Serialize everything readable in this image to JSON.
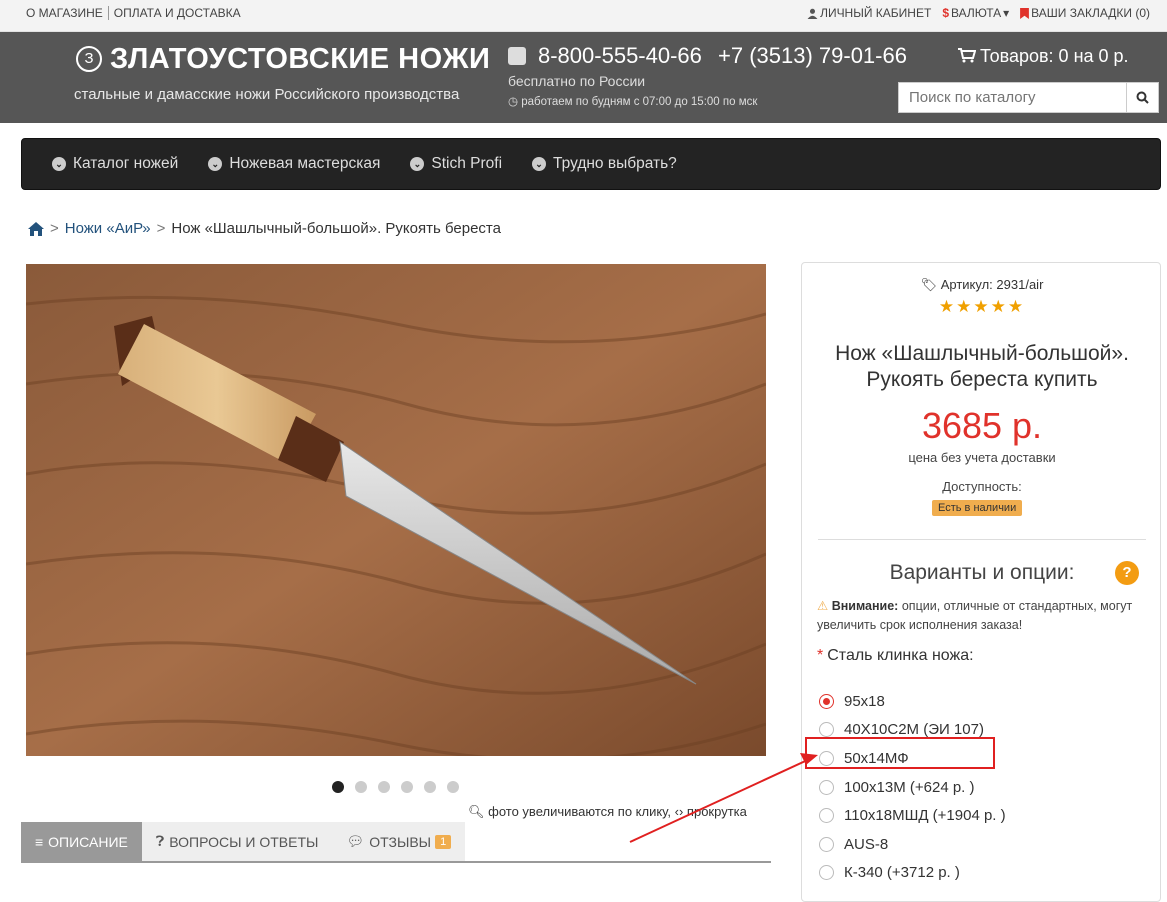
{
  "topbar": {
    "left_links": [
      "О МАГАЗИНЕ",
      "ОПЛАТА И ДОСТАВКА"
    ],
    "account": "ЛИЧНЫЙ КАБИНЕТ",
    "currency_symbol": "$",
    "currency": "ВАЛЮТА",
    "bookmarks": "ВАШИ ЗАКЛАДКИ (0)"
  },
  "header": {
    "logo_mark": "З",
    "logo_title": "ЗЛАТОУСТОВСКИЕ НОЖИ",
    "logo_sub": "стальные и дамасские ножи Российского производства",
    "phone1": "8-800-555-40-66",
    "phone_note": "бесплатно по России",
    "hours": "работаем по будням с 07:00 до 15:00 по мск",
    "phone2": "+7 (3513) 79-01-66",
    "cart": "Товаров: 0 на 0 р.",
    "search_placeholder": "Поиск по каталогу"
  },
  "nav": [
    "Каталог ножей",
    "Ножевая мастерская",
    "Stich Profi",
    "Трудно выбрать?"
  ],
  "breadcrumb": {
    "items": [
      "Ножи «АиР»",
      "Нож «Шашлычный-большой». Рукоять береста"
    ]
  },
  "gallery": {
    "dots": 6,
    "active_dot": 0,
    "zoom_note": "фото увеличиваются по клику,",
    "scroll_note": "прокрутка"
  },
  "tabs": [
    {
      "label": "ОПИСАНИЕ",
      "badge": ""
    },
    {
      "label": "ВОПРОСЫ И ОТВЕТЫ",
      "badge": ""
    },
    {
      "label": "ОТЗЫВЫ",
      "badge": "1"
    }
  ],
  "product": {
    "sku_label": "Артикул:",
    "sku": "2931/air",
    "rating": 5,
    "stars": "★★★★★",
    "title": "Нож «Шашлычный-большой». Рукоять береста купить",
    "price": "3685 р.",
    "price_note": "цена без учета доставки",
    "availability_label": "Доступность:",
    "availability": "Есть в наличии",
    "options_title": "Варианты и опции:",
    "warning_bold": "Внимание:",
    "warning_text": "опции, отличные от стандартных, могут увеличить срок исполнения заказа!",
    "steel_label": "Сталь клинка ножа:",
    "steel_options": [
      {
        "label": "95х18",
        "selected": true
      },
      {
        "label": "40Х10С2М (ЭИ 107)",
        "selected": false
      },
      {
        "label": "50х14МФ",
        "selected": false
      },
      {
        "label": "100х13М (+624 р. )",
        "selected": false
      },
      {
        "label": "110х18МШД (+1904 р. )",
        "selected": false
      },
      {
        "label": "AUS-8",
        "selected": false
      },
      {
        "label": "К-340 (+3712 р. )",
        "selected": false
      }
    ]
  },
  "colors": {
    "header_bg": "#565656",
    "nav_bg": "#232323",
    "price": "#e0322b",
    "badge": "#f0ad4e",
    "highlight": "#e02020"
  }
}
